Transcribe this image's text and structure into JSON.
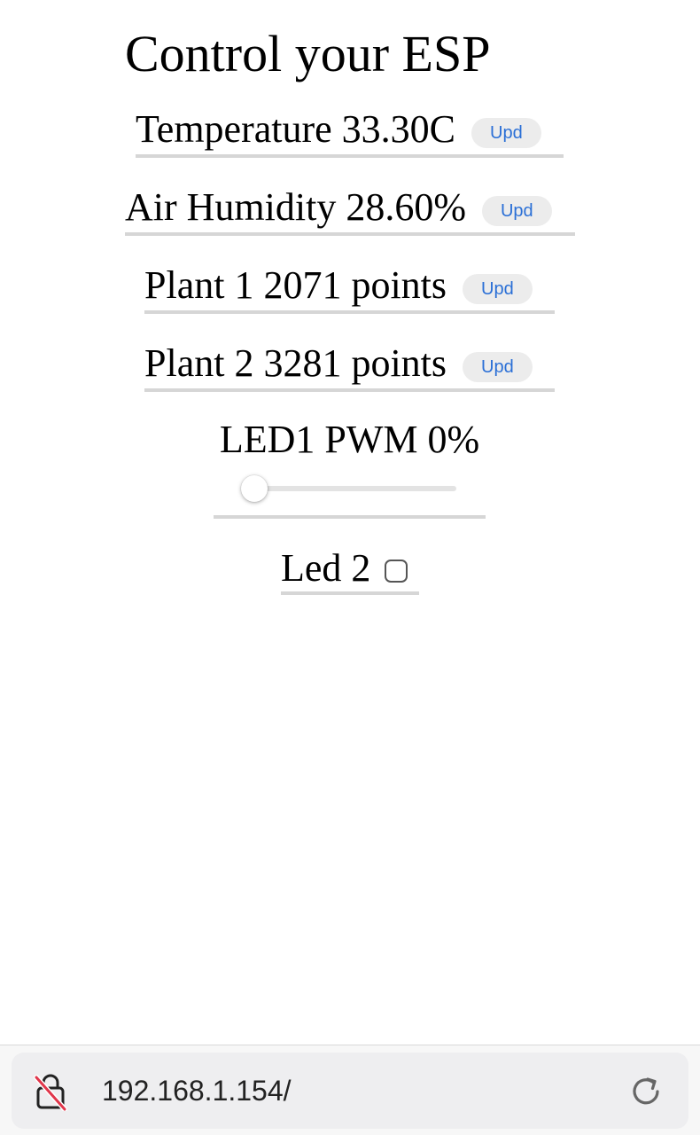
{
  "page": {
    "title": "Control your ESP"
  },
  "readings": {
    "temperature": {
      "label": "Temperature 33.30C",
      "button": "Upd"
    },
    "humidity": {
      "label": "Air Humidity 28.60%",
      "button": "Upd"
    },
    "plant1": {
      "label": "Plant 1 2071 points",
      "button": "Upd"
    },
    "plant2": {
      "label": "Plant 2 3281 points",
      "button": "Upd"
    }
  },
  "led1": {
    "label": "LED1 PWM 0%",
    "pwm_value": 0
  },
  "led2": {
    "label": "Led 2",
    "checked": false
  },
  "browser": {
    "url": "192.168.1.154/",
    "lock_icon": "lock-slash-icon",
    "reload_icon": "reload-icon"
  },
  "colors": {
    "button_text": "#2a6fd6",
    "button_bg": "#ececec",
    "divider": "#d6d6d6",
    "insecure_slash": "#e0364b"
  }
}
